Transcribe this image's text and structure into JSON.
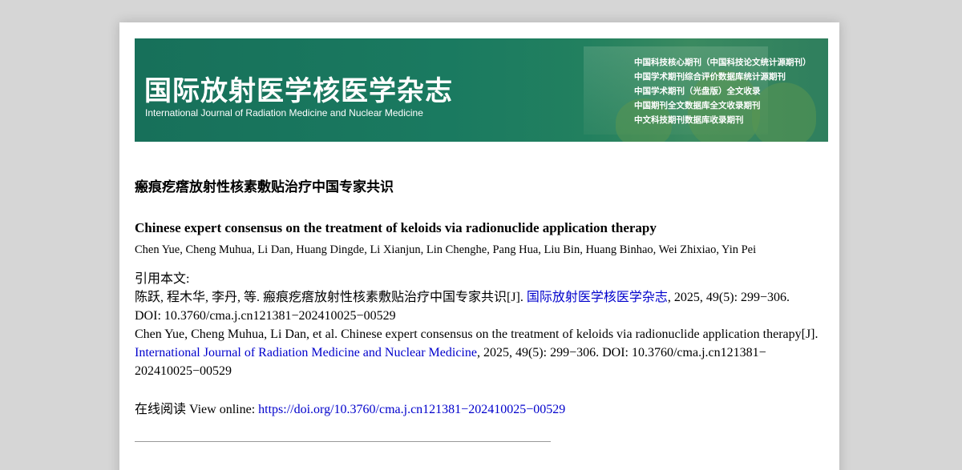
{
  "banner": {
    "title": "国际放射医学核医学杂志",
    "subtitle": "International Journal of Radiation Medicine and Nuclear Medicine",
    "indexing": [
      "中国科技核心期刊（中国科技论文统计源期刊）",
      "中国学术期刊综合评价数据库统计源期刊",
      "中国学术期刊（光盘版）全文收录",
      "中国期刊全文数据库全文收录期刊",
      "中文科技期刊数据库收录期刊"
    ]
  },
  "article": {
    "title_cn": "瘢痕疙瘩放射性核素敷贴治疗中国专家共识",
    "title_en": "Chinese expert consensus on the treatment of keloids via radionuclide application therapy",
    "authors_en": "Chen Yue, Cheng Muhua, Li Dan, Huang Dingde, Li Xianjun, Lin Chenghe, Pang Hua, Liu Bin, Huang Binhao, Wei Zhixiao, Yin Pei"
  },
  "citation": {
    "label": "引用本文:",
    "cn_pre": "陈跃, 程木华, 李丹, 等. 瘢痕疙瘩放射性核素敷贴治疗中国专家共识[J]. ",
    "cn_journal": "国际放射医学核医学杂志",
    "cn_post": ", 2025, 49(5): 299−306.",
    "cn_doi": "DOI: 10.3760/cma.j.cn121381−202410025−00529",
    "en_line1": "Chen Yue, Cheng Muhua, Li Dan, et al. Chinese expert consensus on the treatment of keloids via radionuclide application therapy[J].",
    "en_journal": "International Journal of Radiation Medicine and Nuclear Medicine",
    "en_post": ", 2025, 49(5): 299−306. DOI: 10.3760/cma.j.cn121381−",
    "en_line3": "202410025−00529"
  },
  "online": {
    "label": "在线阅读 View online: ",
    "url": "https://doi.org/10.3760/cma.j.cn121381−202410025−00529"
  },
  "colors": {
    "banner_green": "#17705a",
    "link_blue": "#0000cc"
  }
}
